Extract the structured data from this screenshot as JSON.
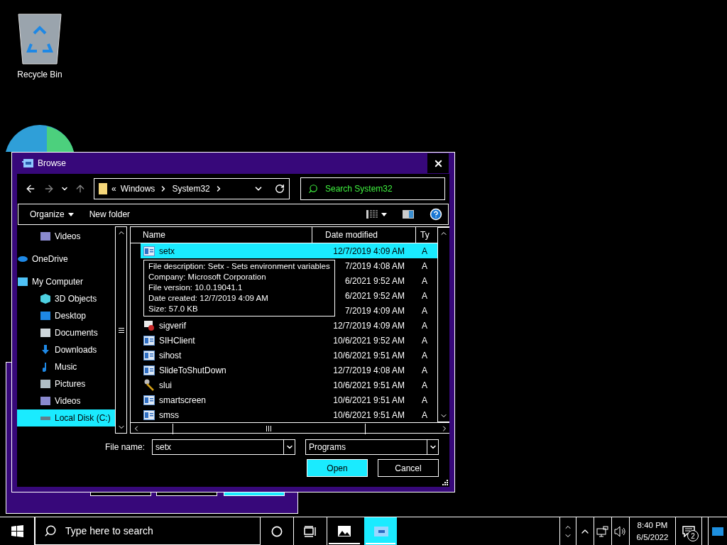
{
  "desktop": {
    "icons": [
      {
        "label": "Recycle Bin"
      }
    ]
  },
  "dialog": {
    "title": "Browse",
    "address": {
      "crumbs": [
        "«",
        "Windows",
        "System32"
      ],
      "search_placeholder": "Search System32"
    },
    "toolbar": {
      "organize": "Organize",
      "new_folder": "New folder"
    },
    "nav_pane": [
      {
        "label": "Videos",
        "kind": "videos",
        "selected": false
      },
      {
        "label": "OneDrive",
        "kind": "cloud",
        "selected": false
      },
      {
        "label": "My Computer",
        "kind": "computer",
        "selected": false,
        "children": [
          {
            "label": "3D Objects",
            "kind": "cube",
            "selected": false
          },
          {
            "label": "Desktop",
            "kind": "desktop",
            "selected": false
          },
          {
            "label": "Documents",
            "kind": "document",
            "selected": false
          },
          {
            "label": "Downloads",
            "kind": "download",
            "selected": false
          },
          {
            "label": "Music",
            "kind": "music",
            "selected": false
          },
          {
            "label": "Pictures",
            "kind": "pictures",
            "selected": false
          },
          {
            "label": "Videos",
            "kind": "videos",
            "selected": false
          },
          {
            "label": "Local Disk (C:)",
            "kind": "disk",
            "selected": true
          }
        ]
      }
    ],
    "columns": [
      "Name",
      "Date modified",
      "Ty"
    ],
    "files": [
      {
        "name": "setx",
        "kind": "app",
        "date": "12/7/2019 4:09 AM",
        "type": "A",
        "selected": true
      },
      {
        "date": "7/2019 4:08 AM",
        "type": "A",
        "selected": false
      },
      {
        "date": "6/2021 9:52 AM",
        "type": "A",
        "selected": false
      },
      {
        "date": "6/2021 9:52 AM",
        "type": "A",
        "selected": false
      },
      {
        "date": "7/2019 4:09 AM",
        "type": "A",
        "selected": false
      },
      {
        "name": "sigverif",
        "kind": "sigverif",
        "date": "12/7/2019 4:09 AM",
        "type": "A",
        "selected": false
      },
      {
        "name": "SIHClient",
        "kind": "app",
        "date": "10/6/2021 9:52 AM",
        "type": "A",
        "selected": false
      },
      {
        "name": "sihost",
        "kind": "app",
        "date": "10/6/2021 9:51 AM",
        "type": "A",
        "selected": false
      },
      {
        "name": "SlideToShutDown",
        "kind": "app",
        "date": "12/7/2019 4:08 AM",
        "type": "A",
        "selected": false
      },
      {
        "name": "slui",
        "kind": "keys",
        "date": "10/6/2021 9:51 AM",
        "type": "A",
        "selected": false
      },
      {
        "name": "smartscreen",
        "kind": "app",
        "date": "10/6/2021 9:51 AM",
        "type": "A",
        "selected": false
      },
      {
        "name": "smss",
        "kind": "app",
        "date": "10/6/2021 9:51 AM",
        "type": "A",
        "selected": false
      }
    ],
    "tooltip": [
      "File description: Setx - Sets environment variables",
      "Company: Microsoft Corporation",
      "File version: 10.0.19041.1",
      "Date created: 12/7/2019 4:09 AM",
      "Size: 57.0 KB"
    ],
    "file_name": {
      "label": "File name:",
      "value": "setx"
    },
    "file_type": {
      "value": "Programs"
    },
    "buttons": [
      {
        "label": "Open",
        "kind": "primary"
      },
      {
        "label": "Cancel",
        "kind": "secondary"
      }
    ]
  },
  "taskbar": {
    "search_placeholder": "Type here to search",
    "apps": [
      {
        "kind": "photos",
        "selected": false
      },
      {
        "kind": "browse",
        "selected": true
      }
    ],
    "time": "8:40 PM",
    "date": "6/5/2022",
    "notifications": "2"
  }
}
